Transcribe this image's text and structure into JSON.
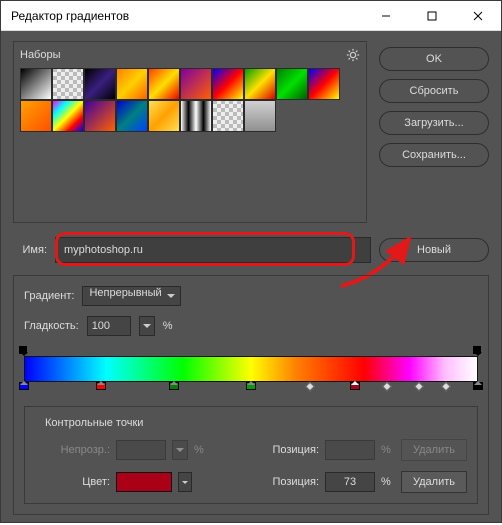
{
  "window": {
    "title": "Редактор градиентов"
  },
  "presets": {
    "label": "Наборы",
    "swatches": [
      "linear-gradient(135deg,#000,#fff)",
      "repeating-conic-gradient(#bbb 0 25%,#eee 0 50%) 0/8px 8px",
      "linear-gradient(135deg,#000,#3a1f80,#000)",
      "linear-gradient(135deg,#ff8000,#ffd000,#ff6000)",
      "linear-gradient(135deg,#ff4000,#ffe000,#e00)",
      "linear-gradient(135deg,#8000a0,#ff6000)",
      "linear-gradient(135deg,#00f,#f00,#ff0)",
      "linear-gradient(135deg,#00a000,#ffe000,#d00)",
      "linear-gradient(135deg,#008000,#00e000,#006000)",
      "linear-gradient(135deg,#00f,#f00,#ff0)",
      "linear-gradient(135deg,#ffa000,#ff5000)",
      "linear-gradient(135deg,#f0f,#0ff,#ff0,#f00,#00f)",
      "linear-gradient(135deg,#4000a0,#ff6000)",
      "linear-gradient(135deg,#0000d0,#008080,#0040ff)",
      "linear-gradient(135deg,#ffe050,#ffa000,#ffe050)",
      "linear-gradient(90deg,#fff,#000,#fff,#000,#fff)",
      "repeating-conic-gradient(#bbb 0 25%,#eee 0 50%) 0/8px 8px",
      "linear-gradient(#d0d0d0,#909090)"
    ]
  },
  "buttons": {
    "ok": "OK",
    "reset": "Сбросить",
    "load": "Загрузить...",
    "save": "Сохранить...",
    "new": "Новый"
  },
  "name": {
    "label": "Имя:",
    "value": "myphotoshop.ru"
  },
  "gradient": {
    "type_label": "Градиент:",
    "type_value": "Непрерывный",
    "smoothness_label": "Гладкость:",
    "smoothness_value": "100",
    "smoothness_unit": "%",
    "opacity_stops": [
      {
        "pos": 0
      },
      {
        "pos": 100
      }
    ],
    "color_stops": [
      {
        "pos": 0,
        "color": "#0000ff"
      },
      {
        "pos": 17,
        "color": "#ff0000"
      },
      {
        "pos": 33,
        "color": "#008000"
      },
      {
        "pos": 50,
        "color": "#00a000"
      },
      {
        "pos": 73,
        "color": "#aa0018",
        "selected": true
      },
      {
        "pos": 100,
        "color": "#000000"
      }
    ],
    "midpoints": [
      63,
      80,
      87,
      93
    ]
  },
  "control_points": {
    "title": "Контрольные точки",
    "opacity_label": "Непрозр.:",
    "opacity_value": "",
    "opacity_unit": "%",
    "opacity_pos_label": "Позиция:",
    "opacity_pos_value": "",
    "opacity_pos_unit": "%",
    "opacity_delete": "Удалить",
    "color_label": "Цвет:",
    "color_value": "#aa0018",
    "color_pos_label": "Позиция:",
    "color_pos_value": "73",
    "color_pos_unit": "%",
    "color_delete": "Удалить"
  }
}
